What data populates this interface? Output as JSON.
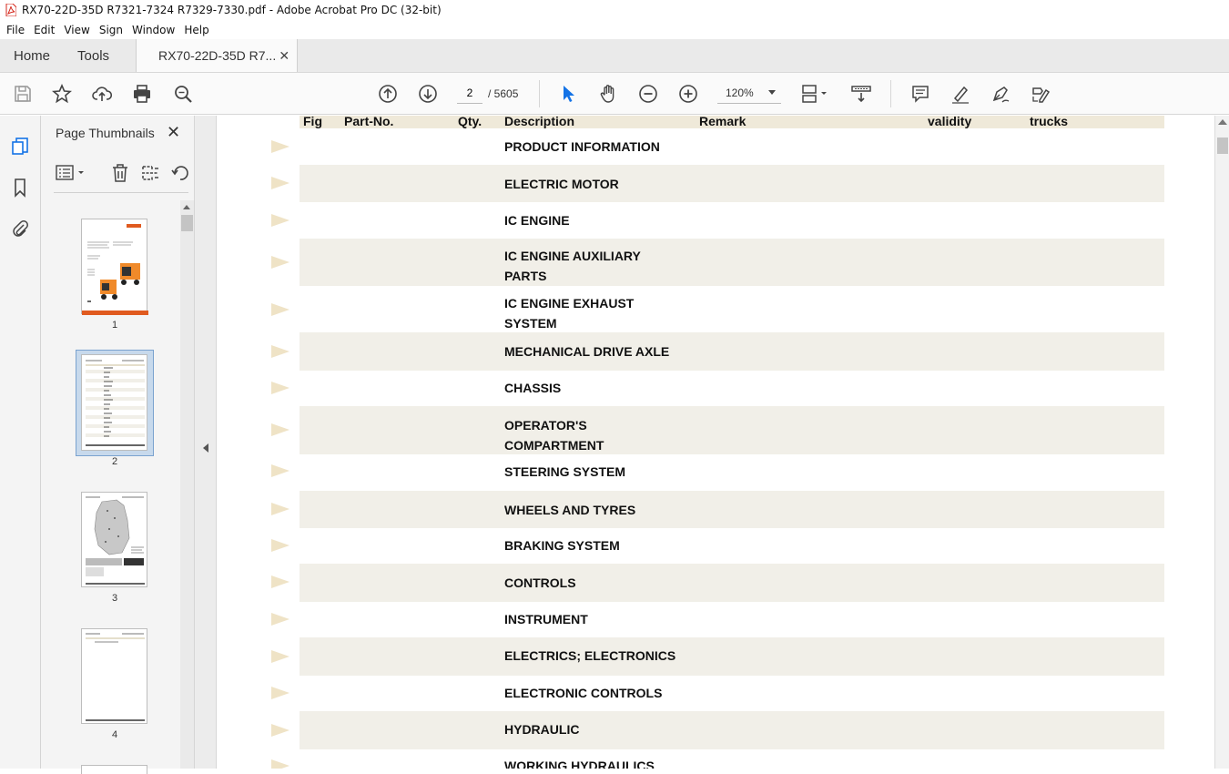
{
  "window": {
    "title": "RX70-22D-35D  R7321-7324  R7329-7330.pdf - Adobe Acrobat Pro DC (32-bit)"
  },
  "menu": [
    "File",
    "Edit",
    "View",
    "Sign",
    "Window",
    "Help"
  ],
  "tabs": {
    "home": "Home",
    "tools": "Tools",
    "document": "RX70-22D-35D  R7..."
  },
  "toolbar": {
    "page_current": "2",
    "page_total": "/  5605",
    "zoom": "120%"
  },
  "thumbnails": {
    "title": "Page Thumbnails",
    "pages": [
      "1",
      "2",
      "3",
      "4"
    ],
    "selected_page": "2"
  },
  "document": {
    "headers": {
      "fig": "Fig",
      "part_no": "Part-No.",
      "qty": "Qty.",
      "description": "Description",
      "remark": "Remark",
      "validity": "validity",
      "trucks": "trucks"
    },
    "rows": [
      "PRODUCT INFORMATION",
      "ELECTRIC MOTOR",
      "IC ENGINE",
      "IC ENGINE AUXILIARY PARTS",
      "IC ENGINE EXHAUST SYSTEM",
      "MECHANICAL DRIVE AXLE",
      "CHASSIS",
      "OPERATOR'S COMPARTMENT",
      "STEERING SYSTEM",
      "WHEELS AND TYRES",
      "BRAKING SYSTEM",
      "CONTROLS",
      "INSTRUMENT",
      "ELECTRICS; ELECTRONICS",
      "ELECTRONIC CONTROLS",
      "HYDRAULIC",
      "WORKING HYDRAULICS"
    ]
  },
  "colors": {
    "header_band": "#efe9d9",
    "row_shade": "#f1efe8",
    "arrow_fill": "#efe3c6",
    "selection": "#c7d9ec",
    "accent_blue": "#1473e6",
    "acrobat_red": "#d4271b"
  }
}
